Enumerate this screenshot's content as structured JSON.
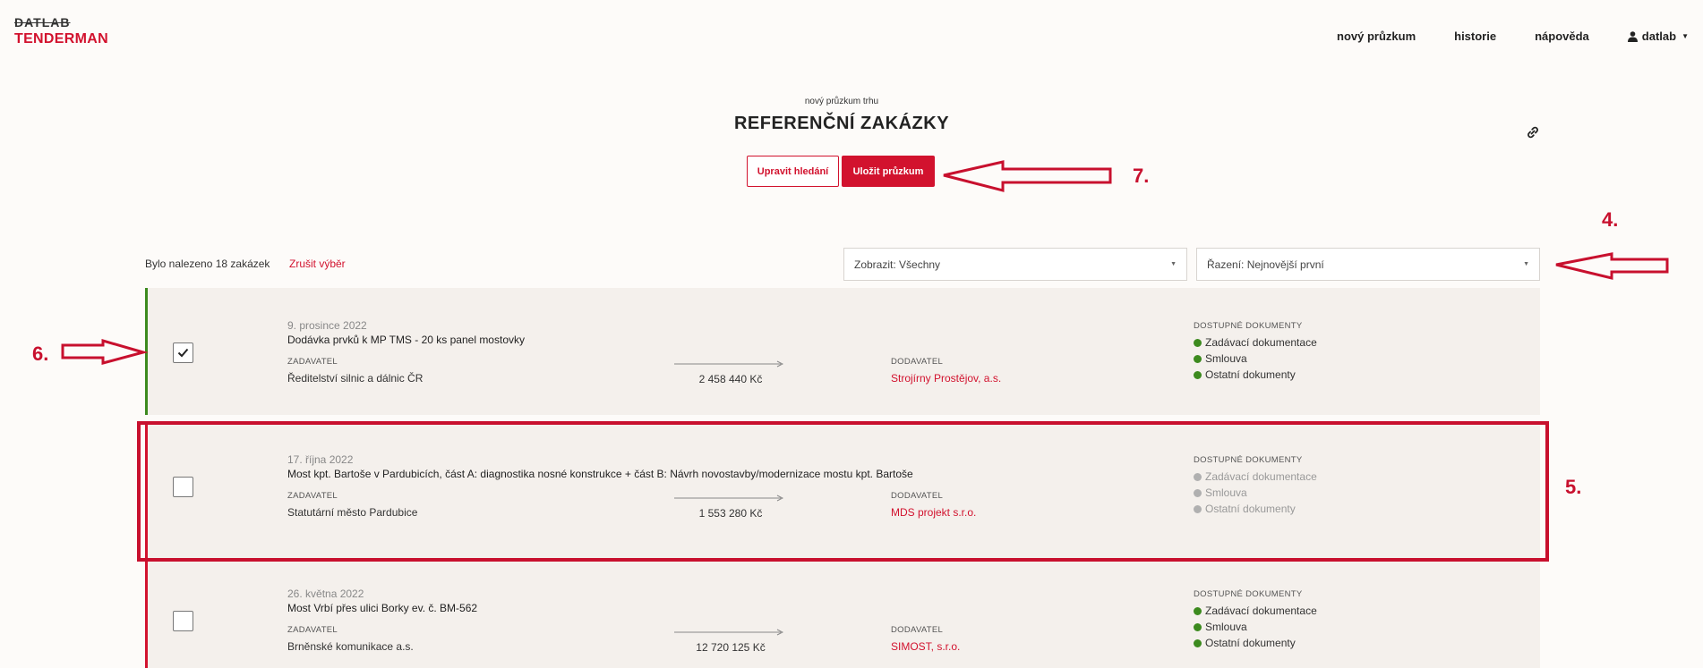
{
  "header": {
    "logo_top": "DATLAB",
    "logo_bottom": "TENDERMAN",
    "nav": [
      "nový průzkum",
      "historie",
      "nápověda"
    ],
    "user": "datlab"
  },
  "page": {
    "subtitle": "nový průzkum trhu",
    "title": "REFERENČNÍ ZAKÁZKY",
    "edit_button": "Upravit hledání",
    "save_button": "Uložit průzkum"
  },
  "filters": {
    "found_text": "Bylo nalezeno 18 zakázek",
    "cancel_selection": "Zrušit výběr",
    "show_select": "Zobrazit: Všechny",
    "sort_select": "Řazení: Nejnovější první"
  },
  "labels": {
    "client": "ZADAVATEL",
    "supplier": "DODAVATEL",
    "docs": "DOSTUPNÉ DOKUMENTY"
  },
  "contracts": [
    {
      "date": "9. prosince 2022",
      "name": "Dodávka prvků k MP TMS - 20 ks panel mostovky",
      "client": "Ředitelství silnic a dálnic ČR",
      "price": "2 458 440 Kč",
      "supplier": "Strojírny Prostějov, a.s.",
      "checked": true,
      "docs": [
        "Zadávací dokumentace",
        "Smlouva",
        "Ostatní dokumenty"
      ],
      "docs_available": true
    },
    {
      "date": "17. října 2022",
      "name": "Most kpt. Bartoše v Pardubicích, část A: diagnostika nosné konstrukce + část B: Návrh novostavby/modernizace mostu kpt. Bartoše",
      "client": "Statutární město Pardubice",
      "price": "1 553 280 Kč",
      "supplier": "MDS projekt s.r.o.",
      "checked": false,
      "docs": [
        "Zadávací dokumentace",
        "Smlouva",
        "Ostatní dokumenty"
      ],
      "docs_available": false
    },
    {
      "date": "26. května 2022",
      "name": "Most Vrbí přes ulici Borky ev. č. BM-562",
      "client": "Brněnské komunikace a.s.",
      "price": "12 720 125 Kč",
      "supplier": "SIMOST, s.r.o.",
      "checked": false,
      "docs": [
        "Zadávací dokumentace",
        "Smlouva",
        "Ostatní dokumenty"
      ],
      "docs_available": true
    }
  ],
  "annotations": {
    "n4": "4.",
    "n5": "5.",
    "n6": "6.",
    "n7": "7."
  },
  "colors": {
    "accent": "#d2122e",
    "checked_bar": "#3c8a1e",
    "doc_available": "#3c8a1e",
    "doc_unavailable": "#b0b0b0",
    "annotation": "#c8102e"
  }
}
